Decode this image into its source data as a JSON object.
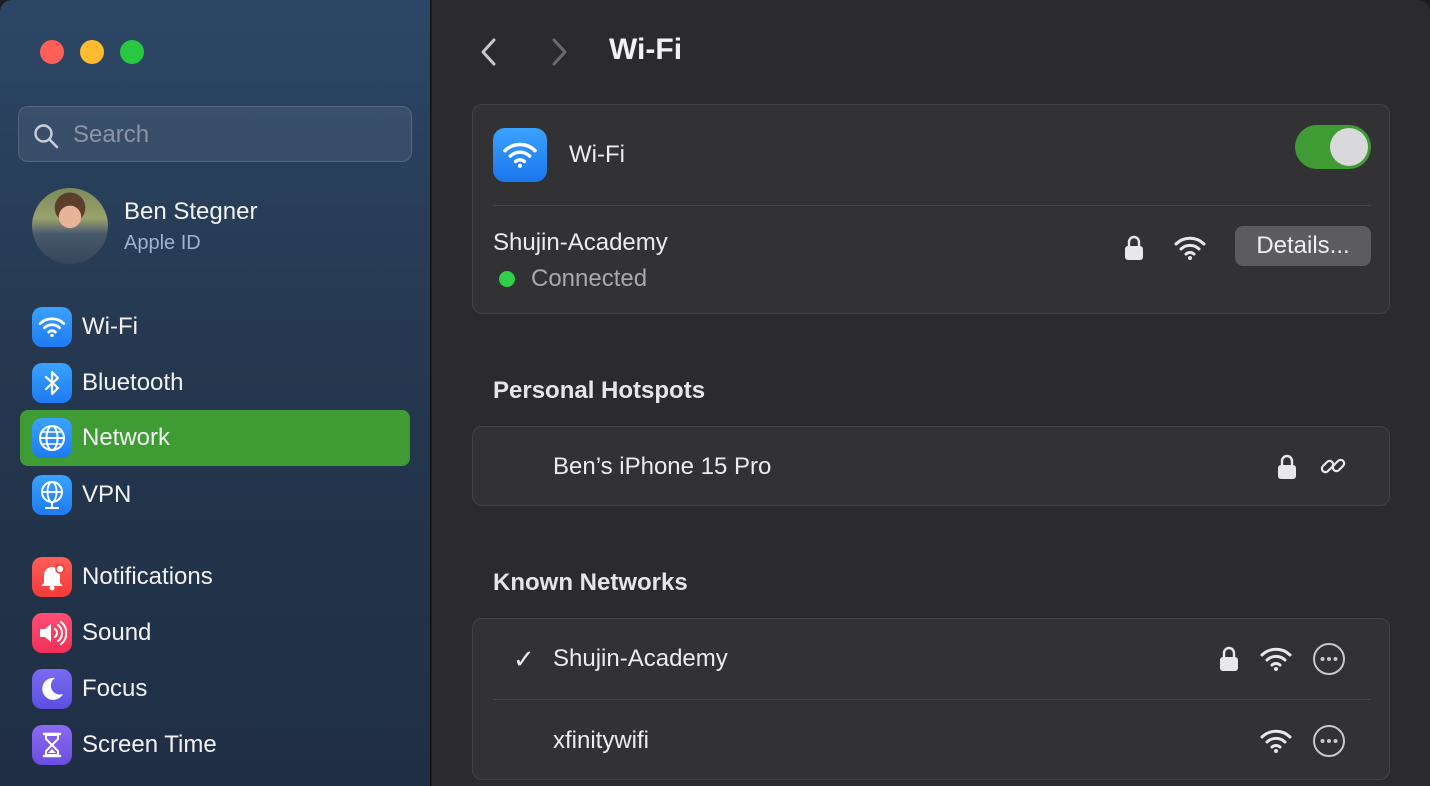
{
  "window": {
    "title": "Wi-Fi"
  },
  "search": {
    "placeholder": "Search"
  },
  "profile": {
    "name": "Ben Stegner",
    "subtitle": "Apple ID"
  },
  "sidebar": {
    "items": [
      {
        "label": "Wi-Fi",
        "icon": "wifi-icon",
        "color": "#1e7bf2"
      },
      {
        "label": "Bluetooth",
        "icon": "bluetooth-icon",
        "color": "#1e7bf2"
      },
      {
        "label": "Network",
        "icon": "globe-icon",
        "color": "#1e7bf2",
        "selected": true
      },
      {
        "label": "VPN",
        "icon": "vpn-globe-icon",
        "color": "#1e7bf2"
      },
      {
        "label": "Notifications",
        "icon": "bell-icon",
        "color": "#f23a3a"
      },
      {
        "label": "Sound",
        "icon": "speaker-icon",
        "color": "#f03058"
      },
      {
        "label": "Focus",
        "icon": "moon-icon",
        "color": "#5b4ee0"
      },
      {
        "label": "Screen Time",
        "icon": "hourglass-icon",
        "color": "#6a4ee0"
      }
    ],
    "selected_color": "#3f9c35"
  },
  "wifi": {
    "label": "Wi-Fi",
    "enabled": true,
    "current_network": "Shujin-Academy",
    "status": "Connected",
    "details_label": "Details..."
  },
  "personal_hotspots": {
    "title": "Personal Hotspots",
    "items": [
      {
        "name": "Ben’s iPhone 15 Pro",
        "locked": true,
        "icon": "link-icon"
      }
    ]
  },
  "known_networks": {
    "title": "Known Networks",
    "items": [
      {
        "name": "Shujin-Academy",
        "connected": true,
        "check": "✓",
        "locked": true
      },
      {
        "name": "xfinitywifi",
        "connected": false,
        "locked": false
      }
    ]
  },
  "colors": {
    "accent_green": "#3f9c35",
    "connected_dot": "#2fcf4a",
    "wifi_blue": "#1e7bf2"
  }
}
